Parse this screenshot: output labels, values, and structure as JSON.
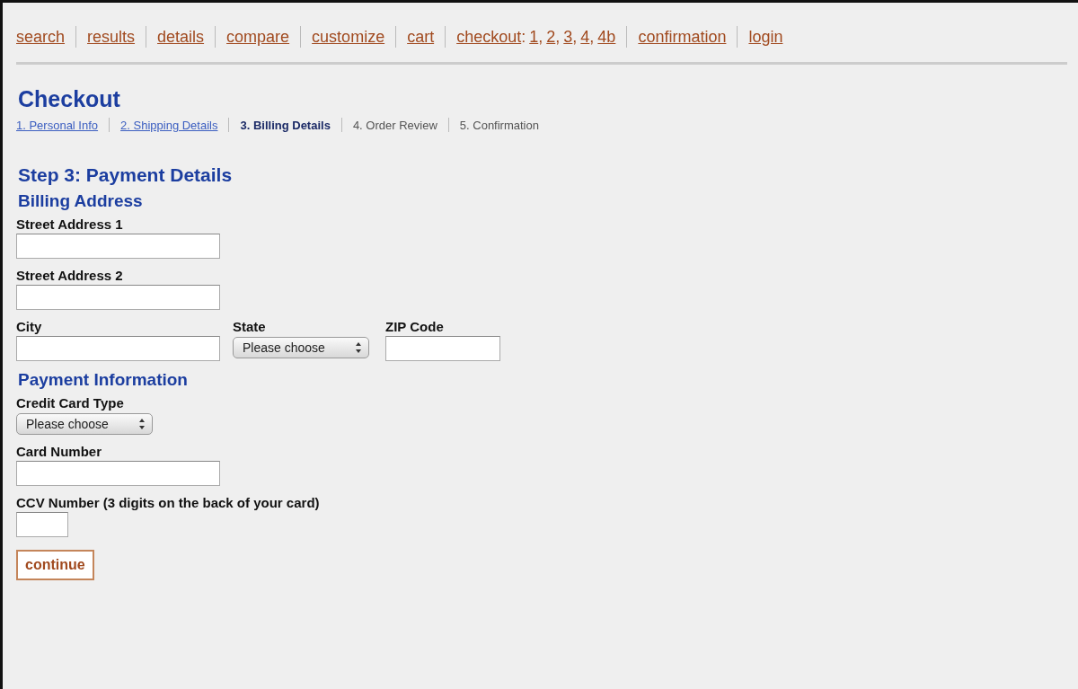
{
  "nav": [
    {
      "label": "search"
    },
    {
      "label": "results"
    },
    {
      "label": "details"
    },
    {
      "label": "compare"
    },
    {
      "label": "customize"
    },
    {
      "label": "cart"
    },
    {
      "label": "checkout",
      "suffix": ":",
      "page_separator": ",",
      "pages": [
        "1",
        "2",
        "3",
        "4",
        "4b"
      ]
    },
    {
      "label": "confirmation"
    },
    {
      "label": "login"
    }
  ],
  "title": "Checkout",
  "steps": [
    {
      "label": "1. Personal Info",
      "kind": "done",
      "selected": false
    },
    {
      "label": "2. Shipping Details",
      "kind": "done",
      "selected": false
    },
    {
      "label": "3. Billing Details",
      "kind": "current",
      "selected": true
    },
    {
      "label": "4. Order Review",
      "kind": "upcoming",
      "selected": false
    },
    {
      "label": "5. Confirmation",
      "kind": "upcoming",
      "selected": false
    }
  ],
  "step_heading": "Step 3: Payment Details",
  "sections": [
    {
      "heading": "Billing Address",
      "rows": [
        [
          {
            "label": "Street Address 1",
            "kind": "text"
          }
        ],
        [
          {
            "label": "Street Address 2",
            "kind": "text"
          }
        ],
        [
          {
            "label": "City",
            "kind": "text"
          },
          {
            "label": "State",
            "kind": "select",
            "value": "Please choose"
          },
          {
            "label": "ZIP Code",
            "kind": "short"
          }
        ]
      ]
    },
    {
      "heading": "Payment Information",
      "rows": [
        [
          {
            "label": "Credit Card Type",
            "kind": "select",
            "value": "Please choose"
          }
        ],
        [
          {
            "label": "Card Number",
            "kind": "text"
          }
        ],
        [
          {
            "label": "CCV Number (3 digits on the back of your card)",
            "kind": "tiny"
          }
        ]
      ]
    }
  ],
  "button": "continue"
}
